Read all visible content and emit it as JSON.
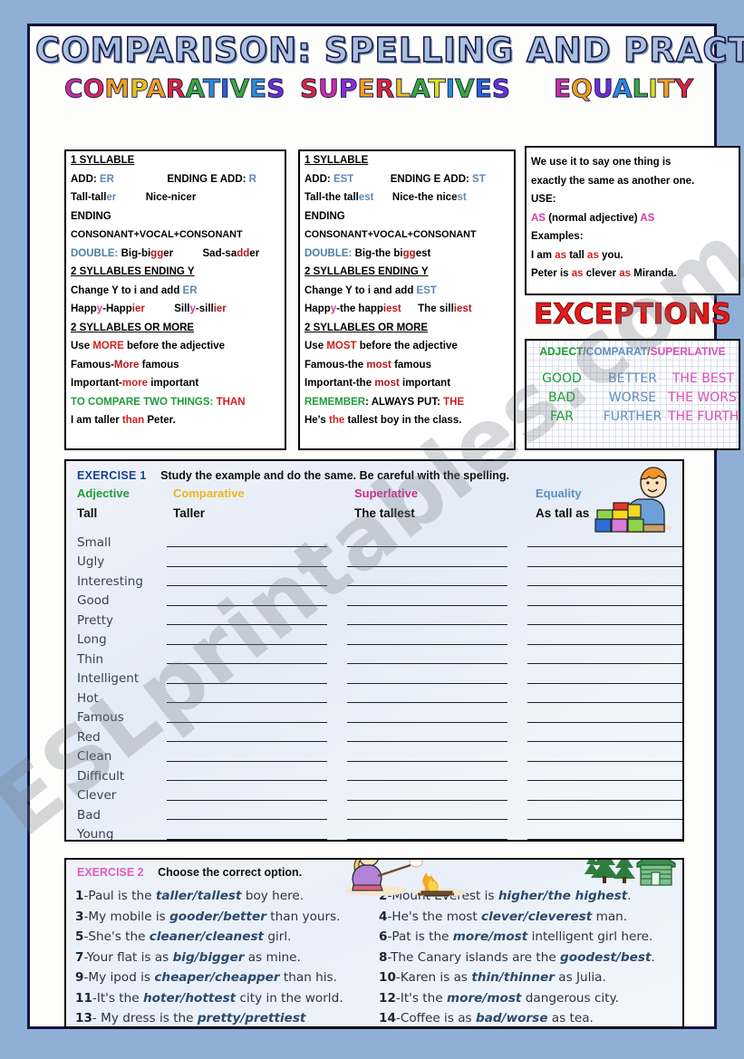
{
  "title": "COMPARISON: SPELLING AND PRACTICE",
  "section_headers": {
    "comparatives": "COMPARATIVES",
    "superlatives": "SUPERLATIVES",
    "equality": "EQUALITY"
  },
  "comparatives": {
    "h1": "1 SYLLABLE",
    "l1a": "ADD:",
    "l1b": "ER",
    "l1c": "ENDING E ADD:",
    "l1d": "R",
    "l2a": "Tall-tall",
    "l2b": "er",
    "l2c": "Nice-nicer",
    "l3": "ENDING",
    "l4": "CONSONANT+VOCAL+CONSONANT",
    "l5a": "DOUBLE:",
    "l5b": "Big-bi",
    "l5c": "gg",
    "l5d": "er",
    "l5e": "Sad-sa",
    "l5f": "dd",
    "l5g": "er",
    "h2": "2 SYLLABLES ENDING Y",
    "l6a": "Change Y to i and add",
    "l6b": "ER",
    "l7a": "Happ",
    "l7b": "y",
    "l7c": "-Happ",
    "l7d": "ier",
    "l7e": "Sill",
    "l7f": "y",
    "l7g": "-sill",
    "l7h": "ier",
    "h3": "2 SYLLABLES OR MORE",
    "l8a": "Use",
    "l8b": "MORE",
    "l8c": "before the adjective",
    "l9a": "Famous-",
    "l9b": "More",
    "l9c": "famous",
    "l10a": "Important-",
    "l10b": "more",
    "l10c": "important",
    "l11a": "TO COMPARE TWO THINGS:",
    "l11b": "THAN",
    "l12a": "I am taller",
    "l12b": "than",
    "l12c": "Peter."
  },
  "superlatives": {
    "h1": "1 SYLLABLE",
    "l1a": "ADD:",
    "l1b": "EST",
    "l1c": "ENDING E ADD:",
    "l1d": "ST",
    "l2a": "Tall-the tall",
    "l2b": "est",
    "l2c": "Nice-the nice",
    "l2d": "st",
    "l3": "ENDING",
    "l4": "CONSONANT+VOCAL+CONSONANT",
    "l5a": "DOUBLE:",
    "l5b": "Big-the bi",
    "l5c": "gg",
    "l5d": "est",
    "h2": "2 SYLLABLES ENDING Y",
    "l6a": "Change Y to i and add",
    "l6b": "EST",
    "l7a": "Happ",
    "l7b": "y",
    "l7c": "-the happ",
    "l7d": "iest",
    "l7e": "The sill",
    "l7f": "iest",
    "h3": "2 SYLLABLES OR MORE",
    "l8a": "Use",
    "l8b": "MOST",
    "l8c": "before the adjective",
    "l9a": "Famous-the",
    "l9b": "most",
    "l9c": "famous",
    "l10a": "Important-the",
    "l10b": "most",
    "l10c": "important",
    "l11a": "REMEMBER",
    "l11b": ": ALWAYS PUT:",
    "l11c": "THE",
    "l12a": "He's",
    "l12b": "the",
    "l12c": "tallest boy in the class."
  },
  "equality": {
    "l1": "We use it to say one thing is",
    "l2": "exactly the same as another one.",
    "l3": "USE:",
    "l4a": "AS",
    "l4b": "(normal adjective)",
    "l4c": "AS",
    "l5": "Examples:",
    "l6a": "I am",
    "l6b": "as",
    "l6c": "tall",
    "l6d": "as",
    "l6e": "you.",
    "l7a": "Peter is",
    "l7b": "as",
    "l7c": "clever",
    "l7d": "as",
    "l7e": "Miranda."
  },
  "exceptions": {
    "title": "EXCEPTIONS",
    "head_adj": "ADJECT",
    "head_sep1": "/",
    "head_comp": "COMPARAT",
    "head_sep2": "/",
    "head_sup": "SUPERLATIVE",
    "rows": [
      {
        "adj": "GOOD",
        "comp": "BETTER",
        "sup": "THE BEST"
      },
      {
        "adj": "BAD",
        "comp": "WORSE",
        "sup": "THE WORST"
      },
      {
        "adj": "FAR",
        "comp": "FURTHER",
        "sup": "THE FURTHEST"
      }
    ]
  },
  "exercise1": {
    "label": "EXERCISE 1",
    "instruction": "Study the example and do the same.  Be careful with the spelling.",
    "columns": [
      "Adjective",
      "Comparative",
      "Superlative",
      "Equality"
    ],
    "example": [
      "Tall",
      "Taller",
      "The tallest",
      "As tall as"
    ],
    "adjectives": [
      "Small",
      "Ugly",
      "Interesting",
      "Good",
      "Pretty",
      "Long",
      "Thin",
      "Intelligent",
      "Hot",
      "Famous",
      "Red",
      "Clean",
      "Difficult",
      "Clever",
      "Bad",
      "Young"
    ]
  },
  "exercise2": {
    "label": "EXERCISE 2",
    "instruction": "Choose the correct option.",
    "left": [
      {
        "n": "1",
        "pre": "-Paul is the ",
        "opt": "taller/tallest",
        "post": " boy here."
      },
      {
        "n": "3",
        "pre": "-My mobile is ",
        "opt": "gooder/better",
        "post": " than yours."
      },
      {
        "n": "5",
        "pre": "-She's the ",
        "opt": "cleaner/cleanest",
        "post": " girl."
      },
      {
        "n": "7",
        "pre": "-Your flat is as ",
        "opt": "big/bigger",
        "post": " as mine."
      },
      {
        "n": "9",
        "pre": "-My ipod is ",
        "opt": "cheaper/cheapper",
        "post": " than his."
      },
      {
        "n": "11",
        "pre": "-It's the ",
        "opt": "hoter/hottest",
        "post": " city in the world."
      },
      {
        "n": "13",
        "pre": "- My dress is the ",
        "opt": "pretty/prettiest",
        "post": ""
      }
    ],
    "right": [
      {
        "n": "2",
        "pre": "-Mount Everest is ",
        "opt": "higher/the highest",
        "post": "."
      },
      {
        "n": "4",
        "pre": "-He's the most ",
        "opt": "clever/cleverest",
        "post": " man."
      },
      {
        "n": "6",
        "pre": "-Pat is the ",
        "opt": "more/most",
        "post": " intelligent girl here."
      },
      {
        "n": "8",
        "pre": "-The Canary islands are the ",
        "opt": "goodest/best",
        "post": "."
      },
      {
        "n": "10",
        "pre": "-Karen is as ",
        "opt": "thin/thinner",
        "post": " as Julia."
      },
      {
        "n": "12",
        "pre": "-It's the ",
        "opt": "more/most",
        "post": " dangerous city."
      },
      {
        "n": "14",
        "pre": "-Coffee is as ",
        "opt": "bad/worse",
        "post": " as tea."
      }
    ]
  },
  "watermark": "ESLprintables.com"
}
